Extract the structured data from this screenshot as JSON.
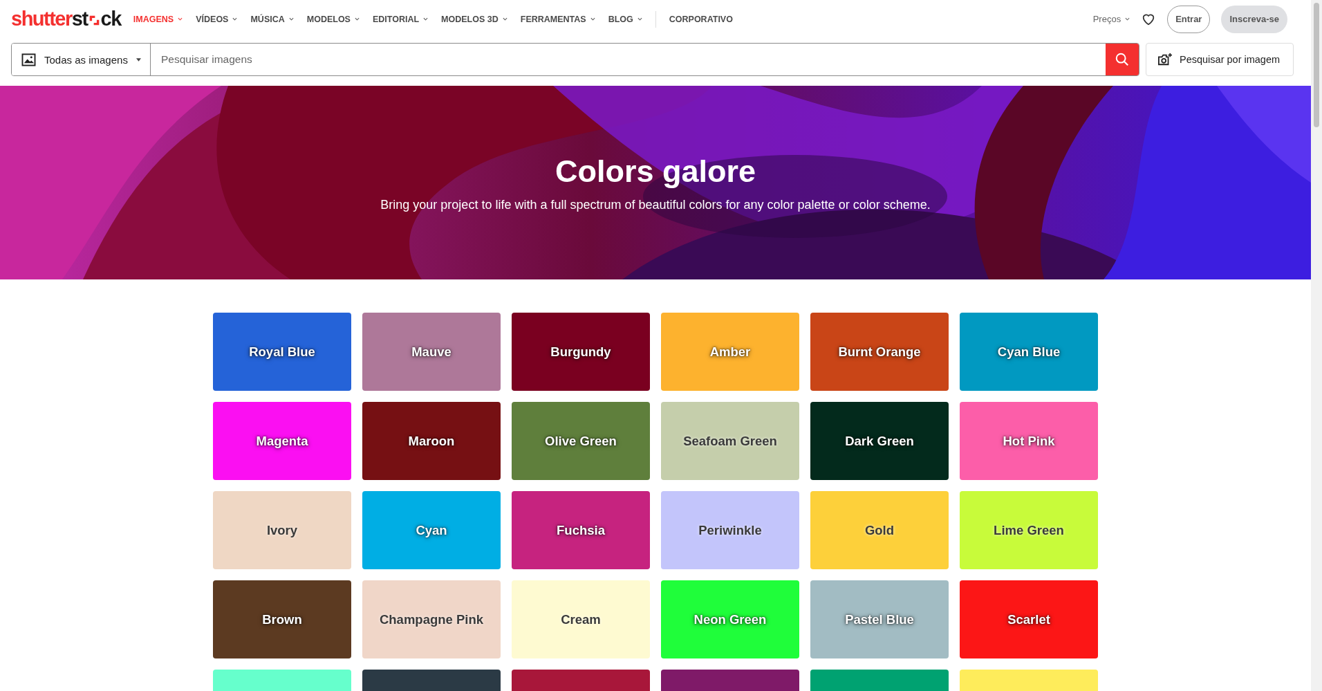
{
  "logo": {
    "left": "shutter",
    "middle": "st",
    "right": "ck"
  },
  "nav": [
    {
      "label": "IMAGENS",
      "selected": true,
      "dropdown": true
    },
    {
      "label": "VÍDEOS",
      "selected": false,
      "dropdown": true
    },
    {
      "label": "MÚSICA",
      "selected": false,
      "dropdown": true
    },
    {
      "label": "MODELOS",
      "selected": false,
      "dropdown": true
    },
    {
      "label": "EDITORIAL",
      "selected": false,
      "dropdown": true
    },
    {
      "label": "MODELOS 3D",
      "selected": false,
      "dropdown": true
    },
    {
      "label": "FERRAMENTAS",
      "selected": false,
      "dropdown": true
    },
    {
      "label": "BLOG",
      "selected": false,
      "dropdown": true
    },
    {
      "label": "CORPORATIVO",
      "selected": false,
      "dropdown": false
    }
  ],
  "pricing": "Preços",
  "login": "Entrar",
  "signup": "Inscreva-se",
  "search": {
    "category": "Todas as imagens",
    "placeholder": "Pesquisar imagens",
    "image_search": "Pesquisar por imagem"
  },
  "hero": {
    "title": "Colors galore",
    "subtitle": "Bring your project to life with a full spectrum of beautiful colors for any color palette or color scheme."
  },
  "colors": [
    {
      "name": "Royal Blue",
      "color": "#2563d8"
    },
    {
      "name": "Mauve",
      "color": "#ae7899"
    },
    {
      "name": "Burgundy",
      "color": "#7a0020"
    },
    {
      "name": "Amber",
      "color": "#fdb22e"
    },
    {
      "name": "Burnt Orange",
      "color": "#c94517"
    },
    {
      "name": "Cyan Blue",
      "color": "#0199c1"
    },
    {
      "name": "Magenta",
      "color": "#fb0ff2"
    },
    {
      "name": "Maroon",
      "color": "#761013"
    },
    {
      "name": "Olive Green",
      "color": "#5f7f3c"
    },
    {
      "name": "Seafoam Green",
      "color": "#c5ceab"
    },
    {
      "name": "Dark Green",
      "color": "#032a1c"
    },
    {
      "name": "Hot Pink",
      "color": "#fc5ea9"
    },
    {
      "name": "Ivory",
      "color": "#efd7c4"
    },
    {
      "name": "Cyan",
      "color": "#00aee4"
    },
    {
      "name": "Fuchsia",
      "color": "#c6237f"
    },
    {
      "name": "Periwinkle",
      "color": "#c3c5fb"
    },
    {
      "name": "Gold",
      "color": "#fdd03a"
    },
    {
      "name": "Lime Green",
      "color": "#c8fb3a"
    },
    {
      "name": "Brown",
      "color": "#5c3a21"
    },
    {
      "name": "Champagne Pink",
      "color": "#f0d6c8"
    },
    {
      "name": "Cream",
      "color": "#fefad1"
    },
    {
      "name": "Neon Green",
      "color": "#1ffe3a"
    },
    {
      "name": "Pastel Blue",
      "color": "#a2bcc3"
    },
    {
      "name": "Scarlet",
      "color": "#fc1616"
    },
    {
      "color": "#66ffcc"
    },
    {
      "color": "#2b3a45"
    },
    {
      "color": "#a8173a"
    },
    {
      "color": "#7f1a68"
    },
    {
      "color": "#00a271"
    },
    {
      "color": "#feec5b"
    }
  ]
}
